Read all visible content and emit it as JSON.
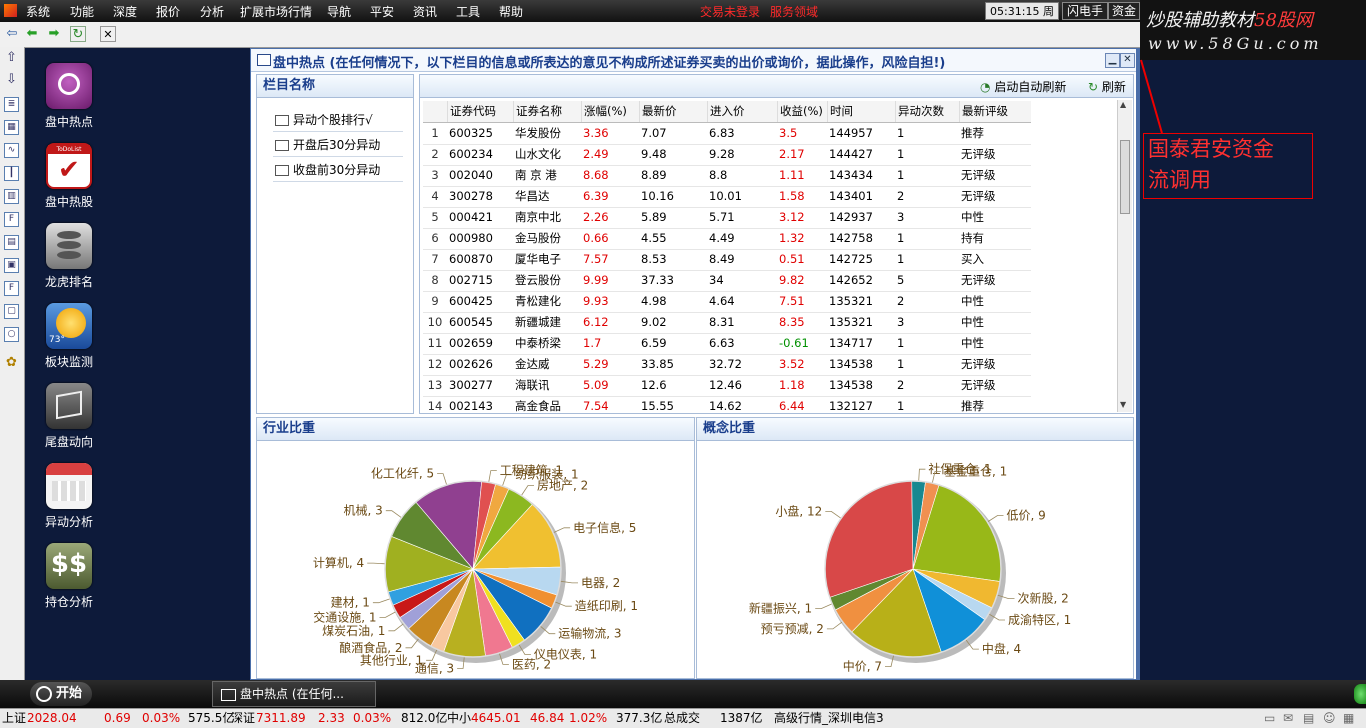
{
  "menubar": {
    "items": [
      "系统",
      "功能",
      "深度",
      "报价",
      "分析",
      "扩展市场行情",
      "导航",
      "平安",
      "资讯",
      "工具",
      "帮助"
    ],
    "alert_left": "交易未登录",
    "alert_right": "服务领域",
    "clock": "05:31:15 周三",
    "btn_flash": "闪电手",
    "btn_fund": "资金"
  },
  "watermark": {
    "brand_a": "炒股辅助教材",
    "brand_b": "58股网",
    "url": "www.58Gu.com"
  },
  "desktop_icons": [
    {
      "label": "盘中热点",
      "icon": "hotspot-icon",
      "color": "#8e2a8a"
    },
    {
      "label": "盘中热股",
      "icon": "todolist-icon",
      "color": "#c01818",
      "badge": "ToDoList"
    },
    {
      "label": "龙虎排名",
      "icon": "database-icon",
      "color": "#8a8a8a"
    },
    {
      "label": "板块监测",
      "icon": "weather-sun-icon",
      "color": "#2e6bb8",
      "badge": "73°"
    },
    {
      "label": "尾盘动向",
      "icon": "map-icon",
      "color": "#4a4a4a"
    },
    {
      "label": "异动分析",
      "icon": "calendar-icon",
      "color": "#d7d7d7"
    },
    {
      "label": "持仓分析",
      "icon": "dollar-icon",
      "color": "#6d7c4d"
    }
  ],
  "window": {
    "title": "盘中热点 (在任何情况下，以下栏目的信息或所表达的意见不构成所述证券买卖的出价或询价，据此操作，风险自担!)",
    "columns_header": "栏目名称",
    "column_items": [
      "异动个股排行√",
      "开盘后30分异动",
      "收盘前30分异动"
    ],
    "auto_refresh": "启动自动刷新",
    "refresh": "刷新"
  },
  "table": {
    "headers": [
      "证券代码",
      "证券名称",
      "涨幅(%)",
      "最新价",
      "进入价",
      "收益(%)",
      "时间",
      "异动次数",
      "最新评级"
    ],
    "rows": [
      [
        "1",
        "600325",
        "华发股份",
        "3.36",
        "7.07",
        "6.83",
        "3.5",
        "144957",
        "1",
        "推荐"
      ],
      [
        "2",
        "600234",
        "山水文化",
        "2.49",
        "9.48",
        "9.28",
        "2.17",
        "144427",
        "1",
        "无评级"
      ],
      [
        "3",
        "002040",
        "南 京 港",
        "8.68",
        "8.89",
        "8.8",
        "1.11",
        "143434",
        "1",
        "无评级"
      ],
      [
        "4",
        "300278",
        "华昌达",
        "6.39",
        "10.16",
        "10.01",
        "1.58",
        "143401",
        "2",
        "无评级"
      ],
      [
        "5",
        "000421",
        "南京中北",
        "2.26",
        "5.89",
        "5.71",
        "3.12",
        "142937",
        "3",
        "中性"
      ],
      [
        "6",
        "000980",
        "金马股份",
        "0.66",
        "4.55",
        "4.49",
        "1.32",
        "142758",
        "1",
        "持有"
      ],
      [
        "7",
        "600870",
        "厦华电子",
        "7.57",
        "8.53",
        "8.49",
        "0.51",
        "142725",
        "1",
        "买入"
      ],
      [
        "8",
        "002715",
        "登云股份",
        "9.99",
        "37.33",
        "34",
        "9.82",
        "142652",
        "5",
        "无评级"
      ],
      [
        "9",
        "600425",
        "青松建化",
        "9.93",
        "4.98",
        "4.64",
        "7.51",
        "135321",
        "2",
        "中性"
      ],
      [
        "10",
        "600545",
        "新疆城建",
        "6.12",
        "9.02",
        "8.31",
        "8.35",
        "135321",
        "3",
        "中性"
      ],
      [
        "11",
        "002659",
        "中泰桥梁",
        "1.7",
        "6.59",
        "6.63",
        "-0.61",
        "134717",
        "1",
        "中性"
      ],
      [
        "12",
        "002626",
        "金达威",
        "5.29",
        "33.85",
        "32.72",
        "3.52",
        "134538",
        "1",
        "无评级"
      ],
      [
        "13",
        "300277",
        "海联讯",
        "5.09",
        "12.6",
        "12.46",
        "1.18",
        "134538",
        "2",
        "无评级"
      ],
      [
        "14",
        "002143",
        "高金食品",
        "7.54",
        "15.55",
        "14.62",
        "6.44",
        "132127",
        "1",
        "推荐"
      ]
    ]
  },
  "chart_data": [
    {
      "type": "pie",
      "title": "行业比重",
      "slices": [
        {
          "label": "纺织服装",
          "value": 1,
          "color": "#f0a840"
        },
        {
          "label": "房地产",
          "value": 2,
          "color": "#8cb820"
        },
        {
          "label": "电子信息",
          "value": 5,
          "color": "#f0c030"
        },
        {
          "label": "电器",
          "value": 2,
          "color": "#b8d8f0"
        },
        {
          "label": "造纸印刷",
          "value": 1,
          "color": "#f09030"
        },
        {
          "label": "运输物流",
          "value": 3,
          "color": "#1070c0"
        },
        {
          "label": "仪电仪表",
          "value": 1,
          "color": "#f0e020"
        },
        {
          "label": "医药",
          "value": 2,
          "color": "#f07890"
        },
        {
          "label": "通信",
          "value": 3,
          "color": "#b8b020"
        },
        {
          "label": "其他行业",
          "value": 1,
          "color": "#f8c8a0"
        },
        {
          "label": "酿酒食品",
          "value": 2,
          "color": "#c88820"
        },
        {
          "label": "煤炭石油",
          "value": 1,
          "color": "#a0a0d8"
        },
        {
          "label": "交通设施",
          "value": 1,
          "color": "#c81818"
        },
        {
          "label": "建材",
          "value": 1,
          "color": "#30a0e0"
        },
        {
          "label": "计算机",
          "value": 4,
          "color": "#a0b020"
        },
        {
          "label": "机械",
          "value": 3,
          "color": "#608830"
        },
        {
          "label": "化工化纤",
          "value": 5,
          "color": "#904090"
        },
        {
          "label": "工程建筑",
          "value": 1,
          "color": "#e05050"
        }
      ]
    },
    {
      "type": "pie",
      "title": "概念比重",
      "slices": [
        {
          "label": "低价",
          "value": 9,
          "color": "#98b818"
        },
        {
          "label": "次新股",
          "value": 2,
          "color": "#f0b830"
        },
        {
          "label": "成渝特区",
          "value": 1,
          "color": "#b8d8f0"
        },
        {
          "label": "中盘",
          "value": 4,
          "color": "#1090d8"
        },
        {
          "label": "中价",
          "value": 7,
          "color": "#b8b018"
        },
        {
          "label": "预亏预减",
          "value": 2,
          "color": "#f09040"
        },
        {
          "label": "新疆振兴",
          "value": 1,
          "color": "#608830"
        },
        {
          "label": "小盘",
          "value": 12,
          "color": "#d84848"
        },
        {
          "label": "社保重仓",
          "value": 1,
          "color": "#188890"
        },
        {
          "label": "基金重仓",
          "value": 1,
          "color": "#f09050"
        }
      ]
    }
  ],
  "annotation": {
    "line1": "国泰君安资金",
    "line2": "流调用"
  },
  "taskbar": {
    "start": "开始",
    "task": "盘中热点 (在任何..."
  },
  "status": {
    "sh_label": "上证",
    "sh_val": "2028.04",
    "sh_chg": "0.69",
    "sh_pct": "0.03%",
    "sh_amt": "575.5亿",
    "sz_label": "深证",
    "sz_val": "7311.89",
    "sz_chg": "2.33",
    "sz_pct": "0.03%",
    "sz_amt": "812.0亿",
    "zx_label": "中小",
    "zx_val": "4645.01",
    "zx_chg": "46.84",
    "zx_pct": "1.02%",
    "zx_amt": "377.3亿",
    "total_label": "总成交",
    "total_val": "1387亿",
    "server": "高级行情_深圳电信3"
  }
}
